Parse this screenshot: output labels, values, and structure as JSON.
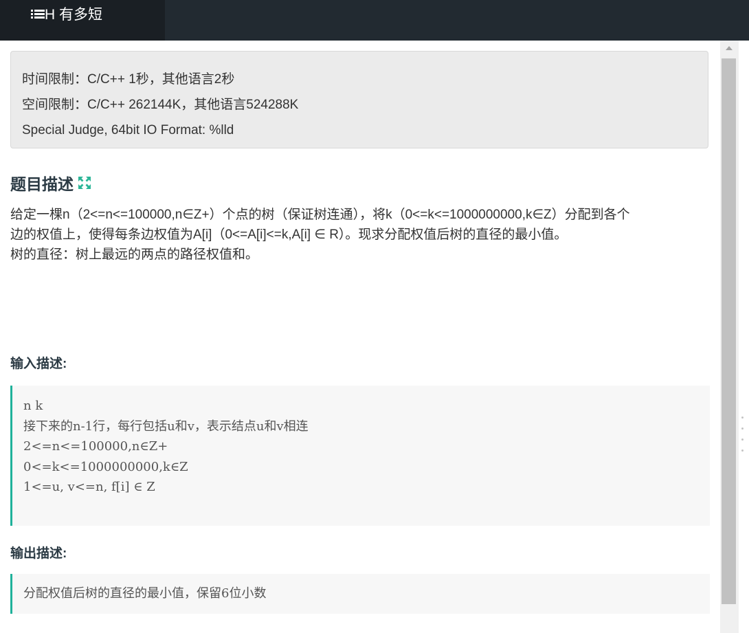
{
  "tab": {
    "icon": "list-icon",
    "title": "H 有多短"
  },
  "limits": {
    "time": "时间限制：C/C++ 1秒，其他语言2秒",
    "memory": "空间限制：C/C++ 262144K，其他语言524288K",
    "judge": "Special Judge, 64bit IO Format: %lld"
  },
  "description": {
    "title": "题目描述",
    "expand_icon": "expand-icon",
    "lines": [
      "给定一棵n（2<=n<=100000,n∈Z+）个点的树（保证树连通），将k（0<=k<=1000000000,k∈Z）分配到各个",
      "边的权值上，使得每条边权值为A[i]（0<=A[i]<=k,A[i] ∈ R）。现求分配权值后树的直径的最小值。",
      "树的直径：树上最远的两点的路径权值和。"
    ]
  },
  "input": {
    "title": "输入描述:",
    "lines": [
      "n k",
      "接下来的n-1行，每行包括u和v，表示结点u和v相连",
      "2<=n<=100000,n∈Z+",
      "0<=k<=1000000000,k∈Z",
      "1<=u, v<=n, f[i] ∈ Z"
    ]
  },
  "output": {
    "title": "输出描述:",
    "lines": [
      "分配权值后树的直径的最小值，保留6位小数"
    ]
  },
  "colors": {
    "accent": "#1fb19a",
    "topbar": "#222a31",
    "panel": "#ebebeb"
  }
}
